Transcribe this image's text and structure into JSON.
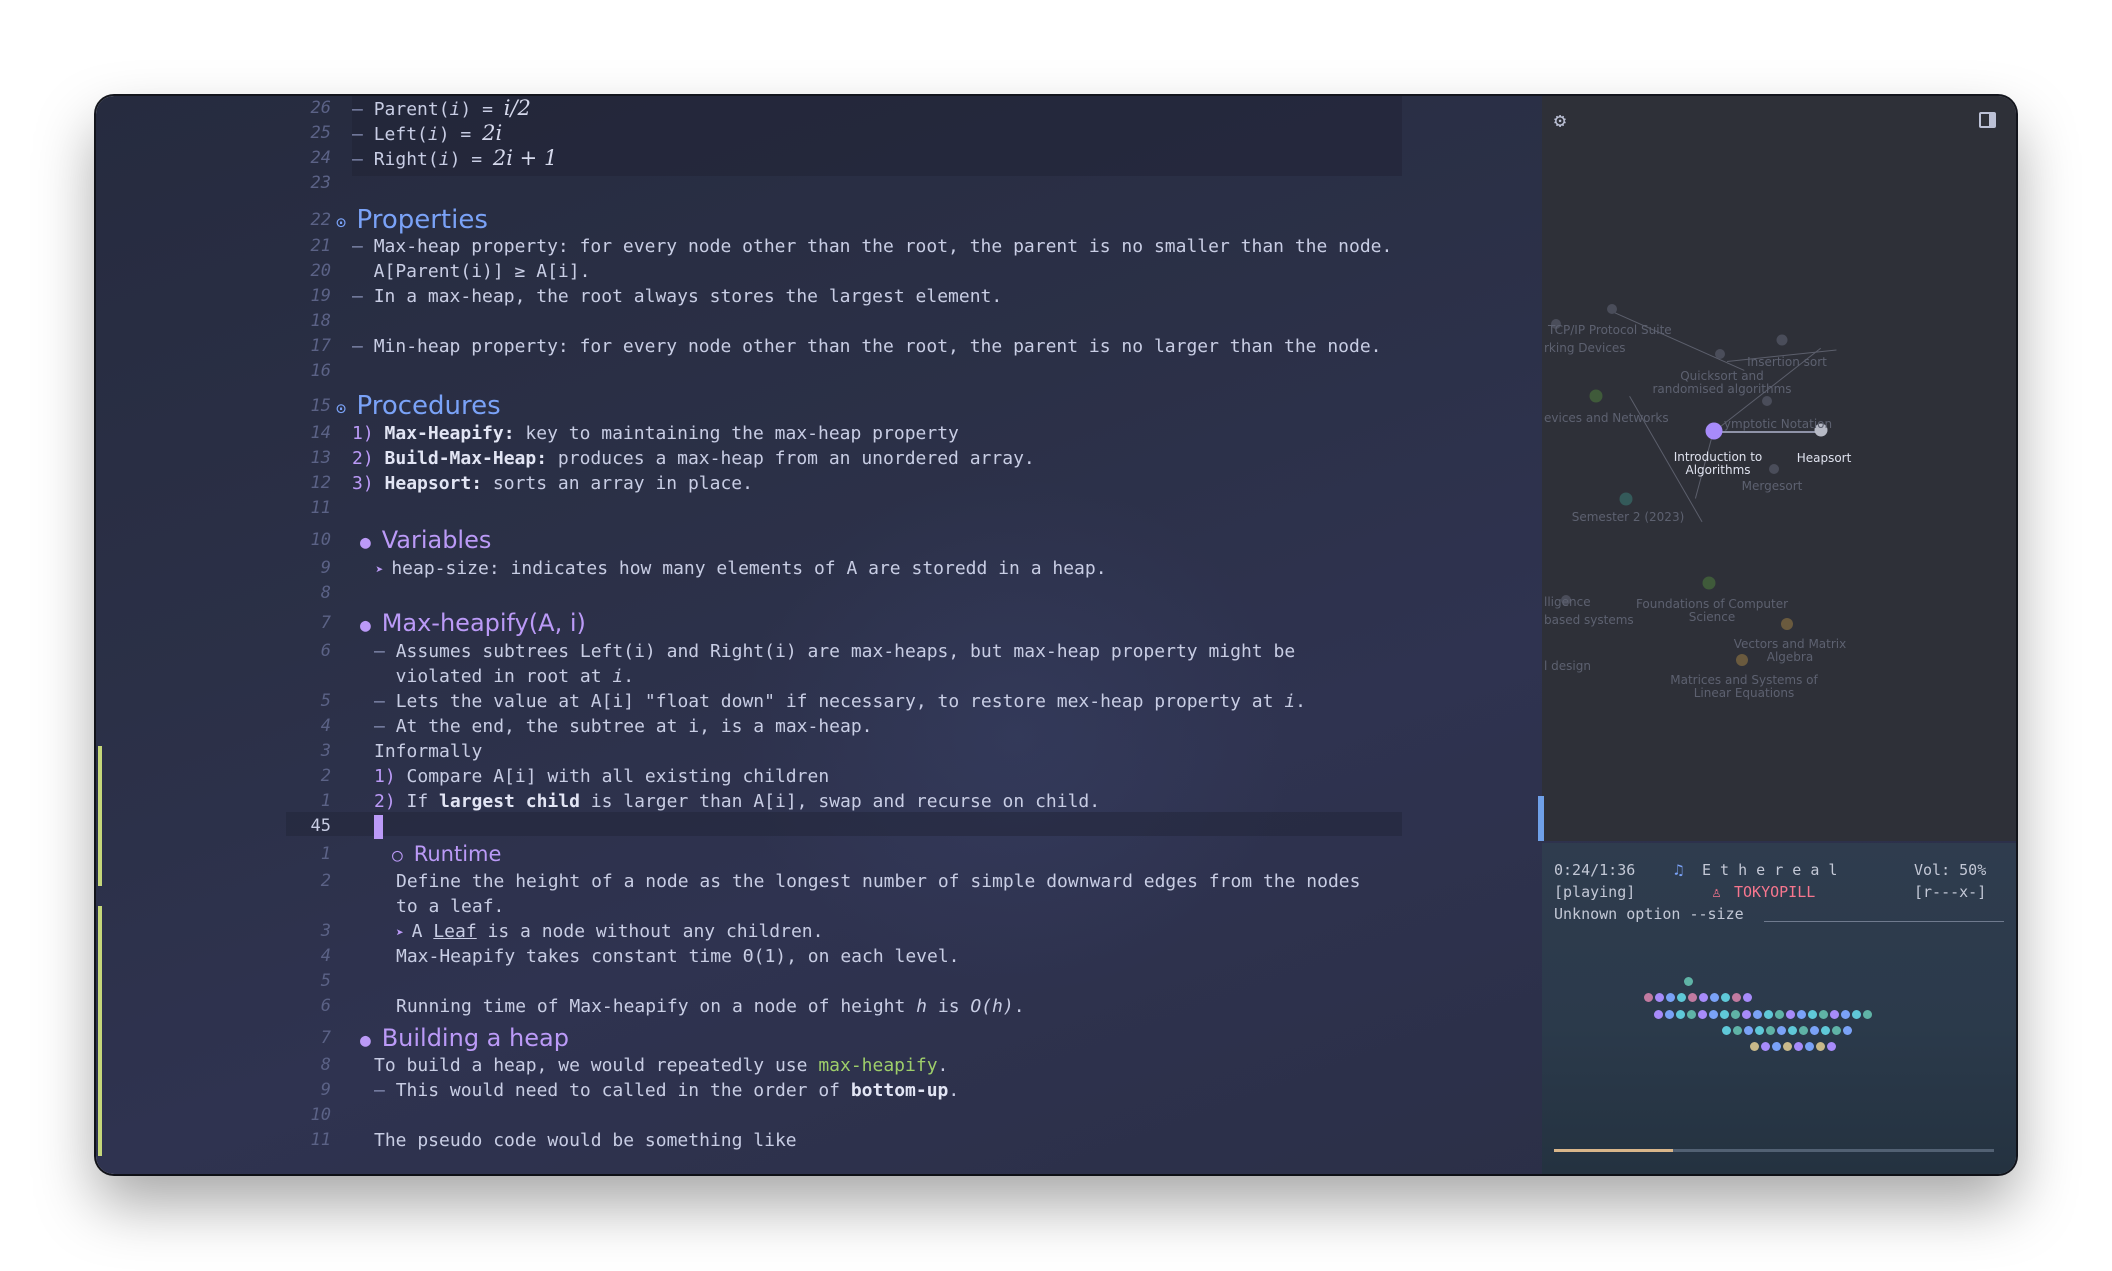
{
  "editor": {
    "lines": [
      {
        "num": "26",
        "parts": [
          {
            "t": "– ",
            "c": "dash"
          },
          {
            "t": "Parent("
          },
          {
            "t": "i",
            "c": "it"
          },
          {
            "t": ") = "
          },
          {
            "t": "i/2",
            "c": "math"
          }
        ]
      },
      {
        "num": "25",
        "parts": [
          {
            "t": "– ",
            "c": "dash"
          },
          {
            "t": "Left("
          },
          {
            "t": "i",
            "c": "it"
          },
          {
            "t": ") = "
          },
          {
            "t": "2i",
            "c": "math"
          }
        ]
      },
      {
        "num": "24",
        "parts": [
          {
            "t": "– ",
            "c": "dash"
          },
          {
            "t": "Right("
          },
          {
            "t": "i",
            "c": "it"
          },
          {
            "t": ") = "
          },
          {
            "t": "2i + 1",
            "c": "math"
          }
        ]
      },
      {
        "num": "23",
        "parts": []
      },
      {
        "num": "22",
        "parts": [
          {
            "t": "⊙ ",
            "c": "bullet-blue"
          },
          {
            "t": "Properties",
            "c": "h-blue"
          }
        ],
        "indent": -16
      },
      {
        "num": "21",
        "parts": [
          {
            "t": "– ",
            "c": "dash"
          },
          {
            "t": "Max-heap property: for every node other than the root, the parent is no smaller than the node."
          }
        ]
      },
      {
        "num": "20",
        "parts": [
          {
            "t": "  A[Parent(i)] ≥ A[i]."
          }
        ]
      },
      {
        "num": "19",
        "parts": [
          {
            "t": "– ",
            "c": "dash"
          },
          {
            "t": "In a max-heap, the root always stores the largest element."
          }
        ]
      },
      {
        "num": "18",
        "parts": []
      },
      {
        "num": "17",
        "parts": [
          {
            "t": "– ",
            "c": "dash"
          },
          {
            "t": "Min-heap property: for every node other than the root, the parent is no larger than the node."
          }
        ]
      },
      {
        "num": "16",
        "parts": []
      },
      {
        "num": "15",
        "parts": [
          {
            "t": "⊙ ",
            "c": "bullet-blue"
          },
          {
            "t": "Procedures",
            "c": "h-blue"
          }
        ],
        "indent": -16
      },
      {
        "num": "14",
        "parts": [
          {
            "t": "1) ",
            "c": "num"
          },
          {
            "t": "Max-Heapify:",
            "c": "b"
          },
          {
            "t": " key to maintaining the max-heap property"
          }
        ]
      },
      {
        "num": "13",
        "parts": [
          {
            "t": "2) ",
            "c": "num"
          },
          {
            "t": "Build-Max-Heap:",
            "c": "b"
          },
          {
            "t": " produces a max-heap from an unordered array."
          }
        ]
      },
      {
        "num": "12",
        "parts": [
          {
            "t": "3) ",
            "c": "num"
          },
          {
            "t": "Heapsort:",
            "c": "b"
          },
          {
            "t": " sorts an array in place."
          }
        ]
      },
      {
        "num": "11",
        "parts": []
      },
      {
        "num": "10",
        "parts": [
          {
            "t": "● ",
            "c": "bullet-mag"
          },
          {
            "t": "Variables",
            "c": "h-mag"
          }
        ],
        "indent": 8
      },
      {
        "num": "9",
        "parts": [
          {
            "t": "  ➤ ",
            "c": "arrow"
          },
          {
            "t": "heap-size: indicates how many elements of A are storedd in a heap."
          }
        ],
        "indent": 8
      },
      {
        "num": "8",
        "parts": []
      },
      {
        "num": "7",
        "parts": [
          {
            "t": "● ",
            "c": "bullet-mag"
          },
          {
            "t": "Max-heapify(A, i)",
            "c": "h-mag"
          }
        ],
        "indent": 8
      },
      {
        "num": "6",
        "parts": [
          {
            "t": "– ",
            "c": "dash"
          },
          {
            "t": "Assumes subtrees Left(i) and Right(i) are max-heaps, but max-heap property might be"
          }
        ],
        "indent": 22
      },
      {
        "num": "",
        "parts": [
          {
            "t": "  violated in root at "
          },
          {
            "t": "i",
            "c": "it"
          },
          {
            "t": "."
          }
        ],
        "indent": 22
      },
      {
        "num": "5",
        "parts": [
          {
            "t": "– ",
            "c": "dash"
          },
          {
            "t": "Lets the value at A[i] \"float down\" if necessary, to restore mex-heap property at "
          },
          {
            "t": "i",
            "c": "it"
          },
          {
            "t": "."
          }
        ],
        "indent": 22
      },
      {
        "num": "4",
        "parts": [
          {
            "t": "– ",
            "c": "dash"
          },
          {
            "t": "At the end, the subtree at i, is a max-heap."
          }
        ],
        "indent": 22
      },
      {
        "num": "3",
        "parts": [
          {
            "t": "Informally"
          }
        ],
        "indent": 22
      },
      {
        "num": "2",
        "parts": [
          {
            "t": "1) ",
            "c": "num"
          },
          {
            "t": "Compare A[i] with all existing children"
          }
        ],
        "indent": 22
      },
      {
        "num": "1",
        "parts": [
          {
            "t": "2) ",
            "c": "num"
          },
          {
            "t": "If "
          },
          {
            "t": "largest child",
            "c": "b"
          },
          {
            "t": " is larger than A[i], swap and recurse on child."
          }
        ],
        "indent": 22
      },
      {
        "num": "45",
        "parts": [
          {
            "t": "",
            "c": "cursor"
          }
        ],
        "indent": 22,
        "current": true
      },
      {
        "num": "1",
        "parts": [
          {
            "t": "○ ",
            "c": "bullet-mag"
          },
          {
            "t": "Runtime",
            "c": "h-sub"
          }
        ],
        "indent": 40
      },
      {
        "num": "2",
        "parts": [
          {
            "t": "Define the height of a node as the longest number of simple downward edges from the nodes"
          }
        ],
        "indent": 44
      },
      {
        "num": "",
        "parts": [
          {
            "t": "to a leaf."
          }
        ],
        "indent": 44
      },
      {
        "num": "3",
        "parts": [
          {
            "t": "➤ ",
            "c": "arrow"
          },
          {
            "t": "A "
          },
          {
            "t": "Leaf",
            "c": "u"
          },
          {
            "t": " is a node without any children."
          }
        ],
        "indent": 44
      },
      {
        "num": "4",
        "parts": [
          {
            "t": "Max-Heapify takes constant time Θ(1), on each level."
          }
        ],
        "indent": 44
      },
      {
        "num": "5",
        "parts": []
      },
      {
        "num": "6",
        "parts": [
          {
            "t": "Running time of Max-heapify on a node of height "
          },
          {
            "t": "h",
            "c": "it"
          },
          {
            "t": " is "
          },
          {
            "t": "O(h)",
            "c": "it"
          },
          {
            "t": "."
          }
        ],
        "indent": 44
      },
      {
        "num": "7",
        "parts": [
          {
            "t": "● ",
            "c": "bullet-mag"
          },
          {
            "t": "Building a heap",
            "c": "h-mag"
          }
        ],
        "indent": 8
      },
      {
        "num": "8",
        "parts": [
          {
            "t": "To build a heap, we would repeatedly use "
          },
          {
            "t": "max-heapify",
            "c": "green"
          },
          {
            "t": "."
          }
        ],
        "indent": 22
      },
      {
        "num": "9",
        "parts": [
          {
            "t": "– ",
            "c": "dash"
          },
          {
            "t": "This would need to called in the order of "
          },
          {
            "t": "bottom-up",
            "c": "b"
          },
          {
            "t": "."
          }
        ],
        "indent": 22
      },
      {
        "num": "10",
        "parts": []
      },
      {
        "num": "11",
        "parts": [
          {
            "t": "The pseudo code would be something like"
          }
        ],
        "indent": 22
      }
    ]
  },
  "graph": {
    "settings_icon": "gear-icon",
    "toggle_icon": "sidebar-toggle-icon",
    "labels": {
      "tcpip": "TCP/IP Protocol Suite",
      "networking_devices": "rking Devices",
      "insertion_sort": "Insertion sort",
      "quicksort": "Quicksort and randomised algorithms",
      "devices_networks": "evices and Networks",
      "asymptotic": "ymptotic Notation",
      "intro_algorithms": "Introduction to Algorithms",
      "heapsort": "Heapsort",
      "mergesort": "Mergesort",
      "semester": "Semester 2 (2023)",
      "intelligence": "lligence",
      "based_systems": "based systems",
      "foundations": "Foundations of Computer Science",
      "vectors": "Vectors and Matrix Algebra",
      "design": "l design",
      "matrices": "Matrices and Systems of Linear Equations"
    },
    "highlight_color": "#a78bfa"
  },
  "player": {
    "time": "0:24/1:36",
    "note_icon": "♫",
    "title": "E t h e r e a l",
    "volume": "Vol: 50%",
    "state": "[playing]",
    "user_icon": "♙",
    "artist": "TOKYOPILL",
    "flags": "[r---x-]",
    "error": "Unknown option --size",
    "progress": 0.27,
    "accent_color": "#f7768e"
  }
}
